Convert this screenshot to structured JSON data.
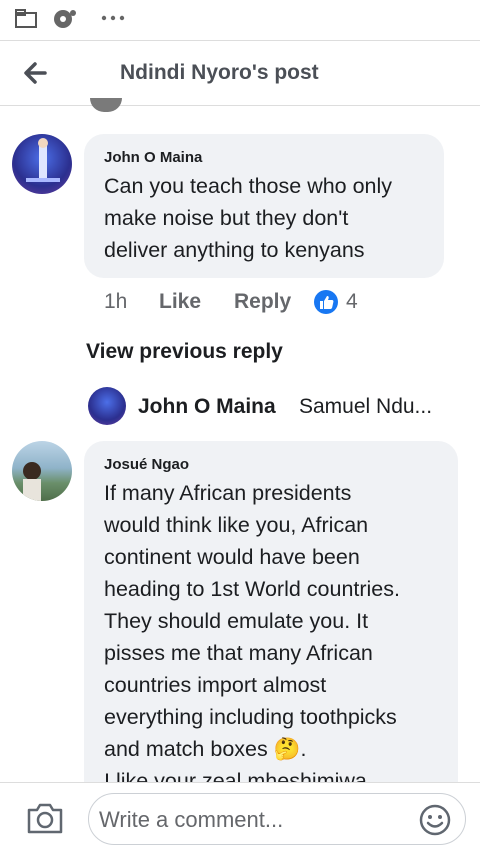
{
  "header": {
    "title": "Ndindi Nyoro's post"
  },
  "comments": [
    {
      "author": "John O Maina",
      "text": "Can you teach those who only\nmake noise but they don't\ndeliver anything to kenyans",
      "time": "1h",
      "like_label": "Like",
      "reply_label": "Reply",
      "reaction_count": "4"
    },
    {
      "author": "Josué Ngao",
      "text": "If many African presidents\nwould think like you, African\ncontinent would have been\nheading to 1st World countries.\nThey should emulate you. It\npisses me that many African\ncountries import almost\neverything including toothpicks\nand match boxes 🤔.\nI like your zeal mheshimiwa"
    }
  ],
  "view_previous_reply": "View previous reply",
  "reply_preview": {
    "author": "John O Maina",
    "text": "Samuel Ndu..."
  },
  "composer": {
    "placeholder": "Write a comment..."
  },
  "colors": {
    "like_blue": "#1877f2",
    "bubble": "#f0f2f5"
  }
}
